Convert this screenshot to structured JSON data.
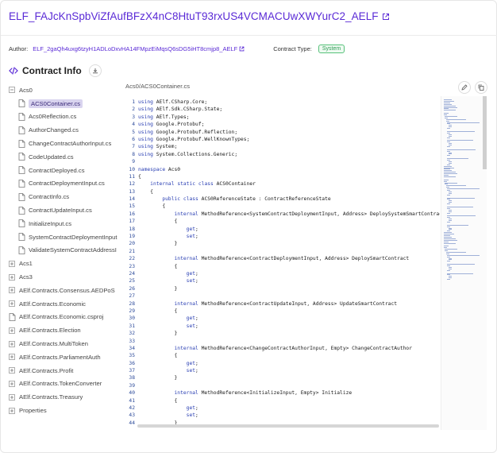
{
  "header": {
    "title": "ELF_FAJcKnSpbViZfAufBFzX4nC8HtuT93rxUS4VCMACUwXWYurC2_AELF",
    "author_label": "Author:",
    "author_value": "ELF_2gaQh4uxg6tzyH1ADLoDxvHA14FMpzEiMqsQ6sDG5iHT8cmjp8_AELF",
    "type_label": "Contract Type:",
    "type_value": "System",
    "accent": "#5a2ad6"
  },
  "section": {
    "title": "Contract Info"
  },
  "tree": {
    "items": [
      {
        "label": "Acs0",
        "kind": "folder-open",
        "level": 0
      },
      {
        "label": "ACS0Container.cs",
        "kind": "file",
        "level": 1,
        "selected": true
      },
      {
        "label": "Acs0Reflection.cs",
        "kind": "file",
        "level": 1
      },
      {
        "label": "AuthorChanged.cs",
        "kind": "file",
        "level": 1
      },
      {
        "label": "ChangeContractAuthorInput.cs",
        "kind": "file",
        "level": 1
      },
      {
        "label": "CodeUpdated.cs",
        "kind": "file",
        "level": 1
      },
      {
        "label": "ContractDeployed.cs",
        "kind": "file",
        "level": 1
      },
      {
        "label": "ContractDeploymentInput.cs",
        "kind": "file",
        "level": 1
      },
      {
        "label": "ContractInfo.cs",
        "kind": "file",
        "level": 1
      },
      {
        "label": "ContractUpdateInput.cs",
        "kind": "file",
        "level": 1
      },
      {
        "label": "InitializeInput.cs",
        "kind": "file",
        "level": 1
      },
      {
        "label": "SystemContractDeploymentInput",
        "kind": "file",
        "level": 1
      },
      {
        "label": "ValidateSystemContractAddressI",
        "kind": "file",
        "level": 1
      },
      {
        "label": "Acs1",
        "kind": "folder",
        "level": 0
      },
      {
        "label": "Acs3",
        "kind": "folder",
        "level": 0
      },
      {
        "label": "AElf.Contracts.Consensus.AEDPoS",
        "kind": "folder",
        "level": 0
      },
      {
        "label": "AElf.Contracts.Economic",
        "kind": "folder",
        "level": 0
      },
      {
        "label": "AElf.Contracts.Economic.csproj",
        "kind": "file",
        "level": 0
      },
      {
        "label": "AElf.Contracts.Election",
        "kind": "folder",
        "level": 0
      },
      {
        "label": "AElf.Contracts.MultiToken",
        "kind": "folder",
        "level": 0
      },
      {
        "label": "AElf.Contracts.ParliamentAuth",
        "kind": "folder",
        "level": 0
      },
      {
        "label": "AElf.Contracts.Profit",
        "kind": "folder",
        "level": 0
      },
      {
        "label": "AElf.Contracts.TokenConverter",
        "kind": "folder",
        "level": 0
      },
      {
        "label": "AElf.Contracts.Treasury",
        "kind": "folder",
        "level": 0
      },
      {
        "label": "Properties",
        "kind": "folder",
        "level": 0
      }
    ]
  },
  "editor": {
    "path": "Acs0/ACS0Container.cs",
    "line_numbers": [
      "1",
      "2",
      "3",
      "4",
      "5",
      "6",
      "7",
      "8",
      "9",
      "10",
      "11",
      "12",
      "13",
      "14",
      "15",
      "16",
      "17",
      "18",
      "19",
      "20",
      "21",
      "22",
      "23",
      "24",
      "25",
      "26",
      "27",
      "28",
      "29",
      "30",
      "31",
      "32",
      "33",
      "34",
      "35",
      "36",
      "37",
      "38",
      "39",
      "40",
      "41",
      "42",
      "43",
      "44"
    ],
    "lines": [
      "using AElf.CSharp.Core;",
      "using AElf.Sdk.CSharp.State;",
      "using AElf.Types;",
      "using Google.Protobuf;",
      "using Google.Protobuf.Reflection;",
      "using Google.Protobuf.WellKnownTypes;",
      "using System;",
      "using System.Collections.Generic;",
      "",
      "namespace Acs0",
      "{",
      "    internal static class ACS0Container",
      "    {",
      "        public class ACS0ReferenceState : ContractReferenceState",
      "        {",
      "            internal MethodReference<SystemContractDeploymentInput, Address> DeploySystemSmartContract",
      "            {",
      "                get;",
      "                set;",
      "            }",
      "",
      "            internal MethodReference<ContractDeploymentInput, Address> DeploySmartContract",
      "            {",
      "                get;",
      "                set;",
      "            }",
      "",
      "            internal MethodReference<ContractUpdateInput, Address> UpdateSmartContract",
      "            {",
      "                get;",
      "                set;",
      "            }",
      "",
      "            internal MethodReference<ChangeContractAuthorInput, Empty> ChangeContractAuthor",
      "            {",
      "                get;",
      "                set;",
      "            }",
      "",
      "            internal MethodReference<InitializeInput, Empty> Initialize",
      "            {",
      "                get;",
      "                set;",
      "            }"
    ]
  }
}
